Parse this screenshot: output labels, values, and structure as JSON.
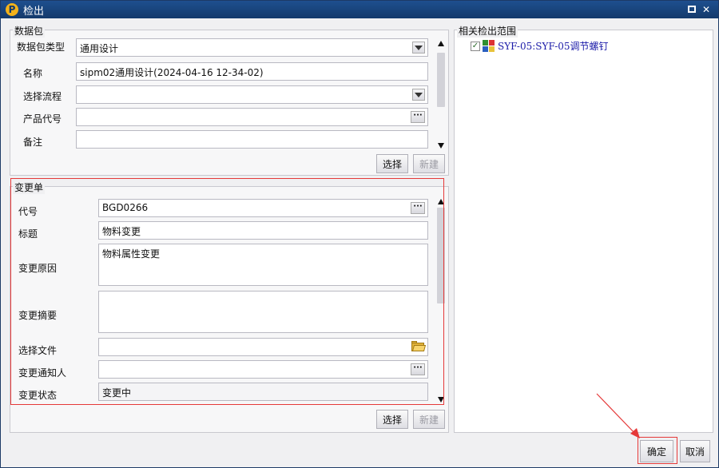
{
  "window": {
    "title": "检出",
    "app_logo": "P"
  },
  "package": {
    "group_title": "数据包",
    "type_label": "数据包类型",
    "type_value": "通用设计",
    "name_label": "名称",
    "name_value": "sipm02通用设计(2024-04-16  12-34-02)",
    "flow_label": "选择流程",
    "flow_value": "",
    "product_label": "产品代号",
    "product_value": "",
    "remark_label": "备注",
    "remark_value": "",
    "select_button": "选择",
    "new_button": "新建"
  },
  "change_order": {
    "group_title": "变更单",
    "code_label": "代号",
    "code_value": "BGD0266",
    "title_label": "标题",
    "title_value": "物料变更",
    "reason_label": "变更原因",
    "reason_value": "物料属性变更",
    "summary_label": "变更摘要",
    "summary_value": "",
    "file_label": "选择文件",
    "file_value": "",
    "notify_label": "变更通知人",
    "notify_value": "",
    "status_label": "变更状态",
    "status_value": "变更中",
    "select_button": "选择",
    "new_button": "新建"
  },
  "scope": {
    "group_title": "相关检出范围",
    "items": [
      {
        "label": "SYF-05:SYF-05调节螺钉",
        "checked": true
      }
    ]
  },
  "footer": {
    "ok_button": "确定",
    "cancel_button": "取消"
  },
  "icons": {
    "dropdown": "chevron-down-icon",
    "ellipsis": "ellipsis-icon",
    "folder": "folder-open-icon",
    "tree_item": "part-icon"
  },
  "colors": {
    "titlebar": "#1e4f8f",
    "highlight": "#e53939",
    "tree_text": "#1a1aa8"
  }
}
